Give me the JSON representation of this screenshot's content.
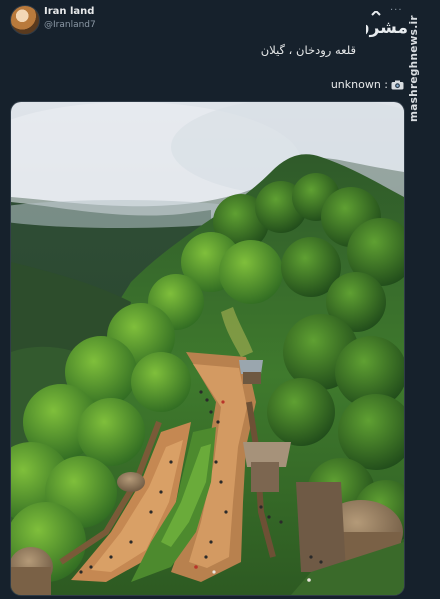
{
  "author": {
    "display_name": "Iran land",
    "handle": "@Iranland7",
    "avatar": "avatar-image"
  },
  "menu": {
    "more_icon": "more-horizontal-icon",
    "more_glyph": "···"
  },
  "watermark": {
    "logo_text": "مشرق",
    "site": "mashreghnews.ir"
  },
  "tweet": {
    "text": "قلعه رودخان ، گیلان",
    "credit_label": "unknown :",
    "credit_icon": "camera-icon"
  },
  "media": {
    "image": "photo-rudkhan-castle"
  },
  "colors": {
    "background": "#16212c",
    "text": "#e7e9ea",
    "muted": "#8b98a5"
  }
}
